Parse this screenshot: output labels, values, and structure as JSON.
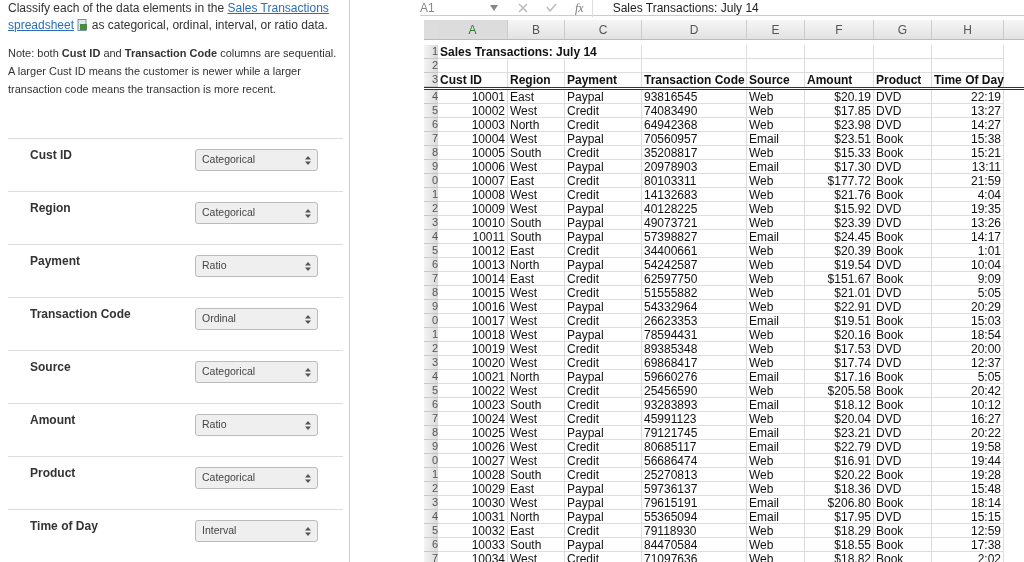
{
  "question": {
    "intro_before": "Classify each of the data elements in the",
    "link_parts": [
      "Sales Transactions",
      "spreadsheet"
    ],
    "intro_after": "as categorical, ordinal, interval, or ratio data.",
    "note": "Note: both **Cust ID** and **Transaction Code** columns are sequential. A larger Cust ID means the customer is newer while a larger transaction code means the transaction is more recent."
  },
  "items": [
    {
      "label": "Cust ID",
      "value": "Categorical"
    },
    {
      "label": "Region",
      "value": "Categorical"
    },
    {
      "label": "Payment",
      "value": "Ratio"
    },
    {
      "label": "Transaction Code",
      "value": "Ordinal"
    },
    {
      "label": "Source",
      "value": "Categorical"
    },
    {
      "label": "Amount",
      "value": "Ratio"
    },
    {
      "label": "Product",
      "value": "Categorical"
    },
    {
      "label": "Time of Day",
      "value": "Interval"
    }
  ],
  "spreadsheet": {
    "name_box": "A1",
    "function_label": "fx",
    "formula": "Sales Transactions: July 14",
    "columns": [
      {
        "label": "A",
        "selected": true
      },
      {
        "label": "B",
        "selected": false
      },
      {
        "label": "C",
        "selected": false
      },
      {
        "label": "D",
        "selected": false
      },
      {
        "label": "E",
        "selected": false
      },
      {
        "label": "F",
        "selected": false
      },
      {
        "label": "G",
        "selected": false
      },
      {
        "label": "H",
        "selected": false
      }
    ],
    "title_row": {
      "row_number": "1",
      "text": "Sales Transactions: July 14"
    },
    "blank_row": {
      "row_number": "2"
    },
    "header_row": {
      "row_number": "3",
      "cells": [
        "Cust ID",
        "Region",
        "Payment",
        "Transaction Code",
        "Source",
        "Amount",
        "Product",
        "Time Of Day"
      ]
    },
    "rows": [
      {
        "row_number": "4",
        "cells": [
          "10001",
          "East",
          "Paypal",
          "93816545",
          "Web",
          "$20.19",
          "DVD",
          "22:19"
        ]
      },
      {
        "row_number": "5",
        "cells": [
          "10002",
          "West",
          "Credit",
          "74083490",
          "Web",
          "$17.85",
          "DVD",
          "13:27"
        ]
      },
      {
        "row_number": "6",
        "cells": [
          "10003",
          "North",
          "Credit",
          "64942368",
          "Web",
          "$23.98",
          "DVD",
          "14:27"
        ]
      },
      {
        "row_number": "7",
        "cells": [
          "10004",
          "West",
          "Paypal",
          "70560957",
          "Email",
          "$23.51",
          "Book",
          "15:38"
        ]
      },
      {
        "row_number": "8",
        "cells": [
          "10005",
          "South",
          "Credit",
          "35208817",
          "Web",
          "$15.33",
          "Book",
          "15:21"
        ]
      },
      {
        "row_number": "9",
        "cells": [
          "10006",
          "West",
          "Paypal",
          "20978903",
          "Email",
          "$17.30",
          "DVD",
          "13:11"
        ]
      },
      {
        "row_number": "0",
        "cells": [
          "10007",
          "East",
          "Credit",
          "80103311",
          "Web",
          "$177.72",
          "Book",
          "21:59"
        ]
      },
      {
        "row_number": "1",
        "cells": [
          "10008",
          "West",
          "Credit",
          "14132683",
          "Web",
          "$21.76",
          "Book",
          "4:04"
        ]
      },
      {
        "row_number": "2",
        "cells": [
          "10009",
          "West",
          "Paypal",
          "40128225",
          "Web",
          "$15.92",
          "DVD",
          "19:35"
        ]
      },
      {
        "row_number": "3",
        "cells": [
          "10010",
          "South",
          "Paypal",
          "49073721",
          "Web",
          "$23.39",
          "DVD",
          "13:26"
        ]
      },
      {
        "row_number": "4",
        "cells": [
          "10011",
          "South",
          "Paypal",
          "57398827",
          "Email",
          "$24.45",
          "Book",
          "14:17"
        ]
      },
      {
        "row_number": "5",
        "cells": [
          "10012",
          "East",
          "Credit",
          "34400661",
          "Web",
          "$20.39",
          "Book",
          "1:01"
        ]
      },
      {
        "row_number": "6",
        "cells": [
          "10013",
          "North",
          "Paypal",
          "54242587",
          "Web",
          "$19.54",
          "DVD",
          "10:04"
        ]
      },
      {
        "row_number": "7",
        "cells": [
          "10014",
          "East",
          "Credit",
          "62597750",
          "Web",
          "$151.67",
          "Book",
          "9:09"
        ]
      },
      {
        "row_number": "8",
        "cells": [
          "10015",
          "West",
          "Credit",
          "51555882",
          "Web",
          "$21.01",
          "DVD",
          "5:05"
        ]
      },
      {
        "row_number": "9",
        "cells": [
          "10016",
          "West",
          "Paypal",
          "54332964",
          "Web",
          "$22.91",
          "DVD",
          "20:29"
        ]
      },
      {
        "row_number": "0",
        "cells": [
          "10017",
          "West",
          "Credit",
          "26623353",
          "Email",
          "$19.51",
          "Book",
          "15:03"
        ]
      },
      {
        "row_number": "1",
        "cells": [
          "10018",
          "West",
          "Paypal",
          "78594431",
          "Web",
          "$20.16",
          "Book",
          "18:54"
        ]
      },
      {
        "row_number": "2",
        "cells": [
          "10019",
          "West",
          "Credit",
          "89385348",
          "Web",
          "$17.53",
          "DVD",
          "20:00"
        ]
      },
      {
        "row_number": "3",
        "cells": [
          "10020",
          "West",
          "Credit",
          "69868417",
          "Web",
          "$17.74",
          "DVD",
          "12:37"
        ]
      },
      {
        "row_number": "4",
        "cells": [
          "10021",
          "North",
          "Paypal",
          "59660276",
          "Email",
          "$17.16",
          "Book",
          "5:05"
        ]
      },
      {
        "row_number": "5",
        "cells": [
          "10022",
          "West",
          "Credit",
          "25456590",
          "Web",
          "$205.58",
          "Book",
          "20:42"
        ]
      },
      {
        "row_number": "6",
        "cells": [
          "10023",
          "South",
          "Credit",
          "93283893",
          "Email",
          "$18.12",
          "Book",
          "10:12"
        ]
      },
      {
        "row_number": "7",
        "cells": [
          "10024",
          "West",
          "Credit",
          "45991123",
          "Web",
          "$20.04",
          "DVD",
          "16:27"
        ]
      },
      {
        "row_number": "8",
        "cells": [
          "10025",
          "West",
          "Paypal",
          "79121745",
          "Email",
          "$23.21",
          "DVD",
          "20:22"
        ]
      },
      {
        "row_number": "9",
        "cells": [
          "10026",
          "West",
          "Credit",
          "80685117",
          "Email",
          "$22.79",
          "DVD",
          "19:58"
        ]
      },
      {
        "row_number": "0",
        "cells": [
          "10027",
          "West",
          "Credit",
          "56686474",
          "Web",
          "$16.91",
          "DVD",
          "19:44"
        ]
      },
      {
        "row_number": "1",
        "cells": [
          "10028",
          "South",
          "Credit",
          "25270813",
          "Web",
          "$20.22",
          "Book",
          "19:28"
        ]
      },
      {
        "row_number": "2",
        "cells": [
          "10029",
          "East",
          "Paypal",
          "59736137",
          "Web",
          "$18.36",
          "DVD",
          "15:48"
        ]
      },
      {
        "row_number": "3",
        "cells": [
          "10030",
          "West",
          "Paypal",
          "79615191",
          "Email",
          "$206.80",
          "Book",
          "18:14"
        ]
      },
      {
        "row_number": "4",
        "cells": [
          "10031",
          "North",
          "Paypal",
          "55365094",
          "Email",
          "$17.95",
          "DVD",
          "15:15"
        ]
      },
      {
        "row_number": "5",
        "cells": [
          "10032",
          "East",
          "Credit",
          "79118930",
          "Web",
          "$18.29",
          "Book",
          "12:59"
        ]
      },
      {
        "row_number": "6",
        "cells": [
          "10033",
          "South",
          "Paypal",
          "84470584",
          "Web",
          "$18.55",
          "Book",
          "17:38"
        ]
      },
      {
        "row_number": "7",
        "cells": [
          "10034",
          "West",
          "Credit",
          "71097636",
          "Web",
          "$18.82",
          "Book",
          "2:02"
        ]
      }
    ]
  }
}
